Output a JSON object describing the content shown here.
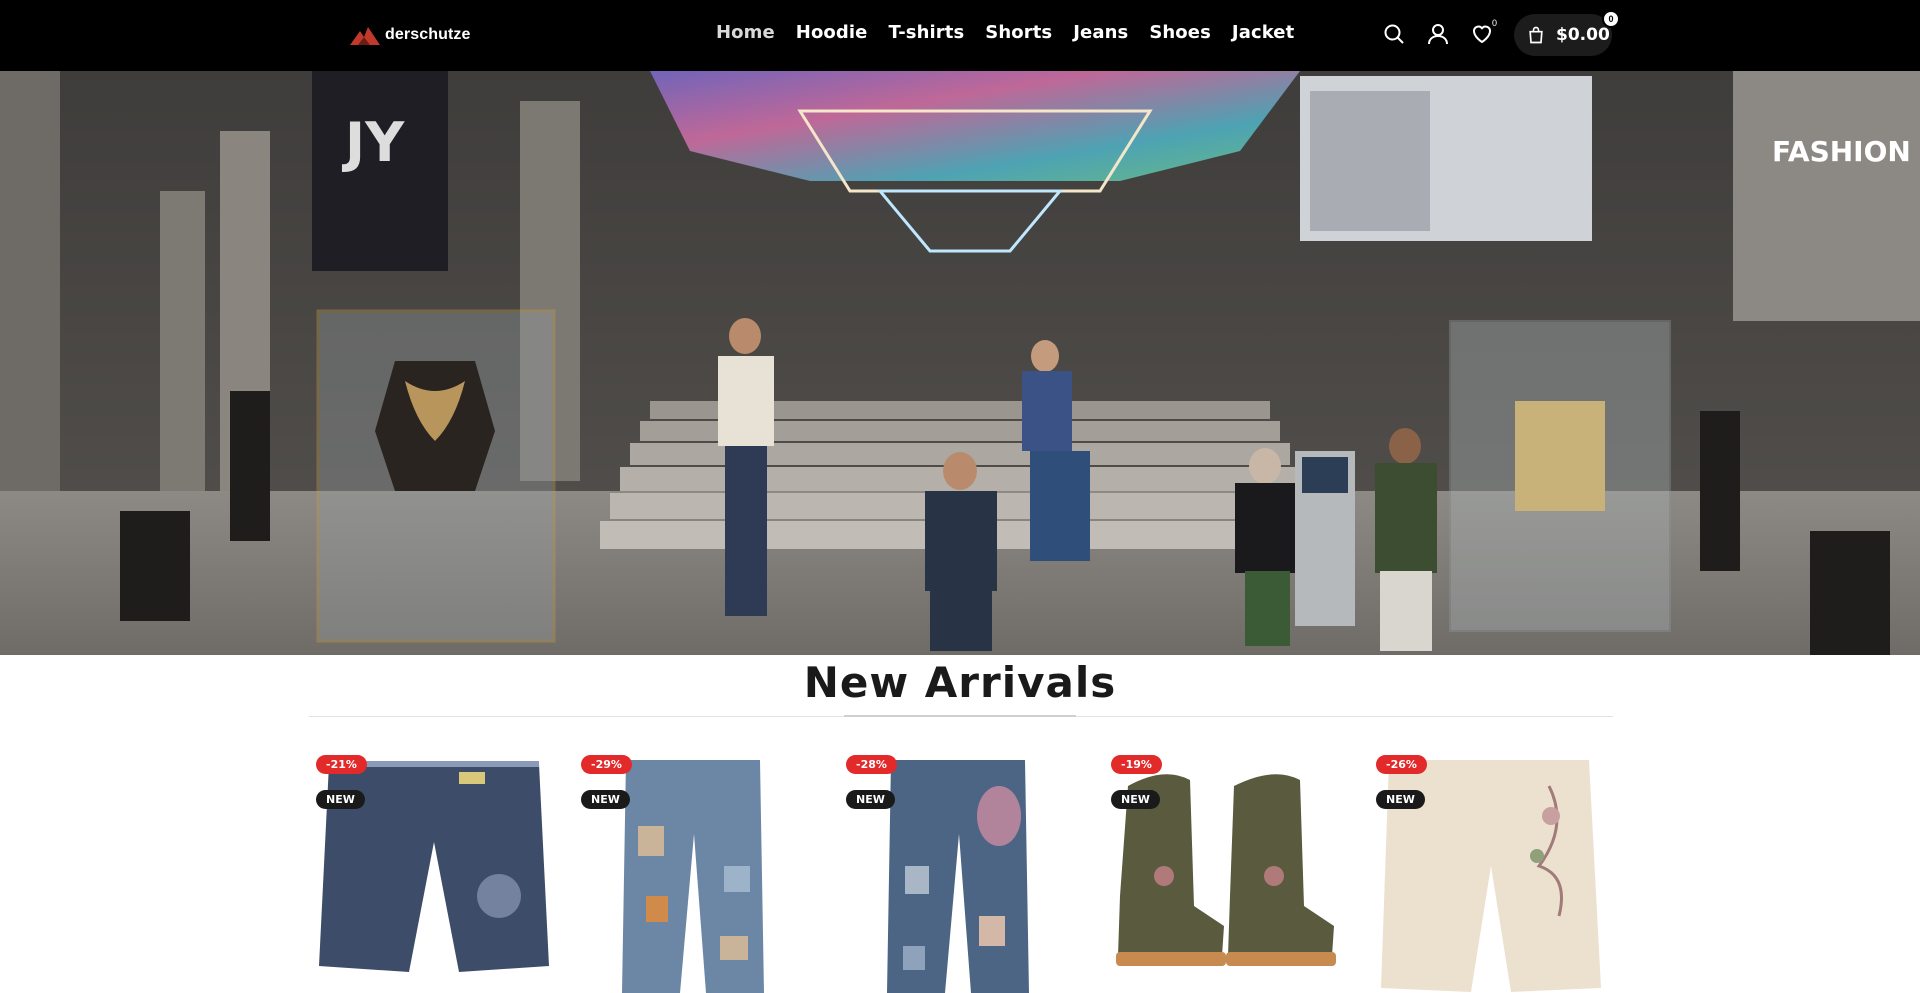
{
  "brand": {
    "name": "derschutze"
  },
  "nav": {
    "items": [
      {
        "label": "Home",
        "active": true
      },
      {
        "label": "Hoodie"
      },
      {
        "label": "T-shirts"
      },
      {
        "label": "Shorts"
      },
      {
        "label": "Jeans"
      },
      {
        "label": "Shoes"
      },
      {
        "label": "Jacket"
      }
    ]
  },
  "header_icons": {
    "search": "search-icon",
    "account": "user-icon",
    "wishlist": "heart-icon",
    "wishlist_count": "0",
    "cart": "bag-icon"
  },
  "cart": {
    "amount": "$0.00",
    "count": "0"
  },
  "hero": {
    "banner_left_text": "",
    "banner_right_title": "FASHION"
  },
  "section": {
    "title": "New Arrivals"
  },
  "products": [
    {
      "discount": "-21%",
      "badge": "NEW",
      "type": "shorts",
      "colors": {
        "main": "#3a4a66",
        "accent": "#8b9ab8"
      }
    },
    {
      "discount": "-29%",
      "badge": "NEW",
      "type": "jeans",
      "colors": {
        "main": "#6c87a6",
        "accent": "#c9b49a"
      }
    },
    {
      "discount": "-28%",
      "badge": "NEW",
      "type": "jeans",
      "colors": {
        "main": "#4d6585",
        "accent": "#c48aa0"
      }
    },
    {
      "discount": "-19%",
      "badge": "NEW",
      "type": "boots",
      "colors": {
        "main": "#5a5a3f",
        "accent": "#c78a4f"
      }
    },
    {
      "discount": "-26%",
      "badge": "NEW",
      "type": "shorts",
      "colors": {
        "main": "#ece1cf",
        "accent": "#a07b7a"
      }
    }
  ]
}
